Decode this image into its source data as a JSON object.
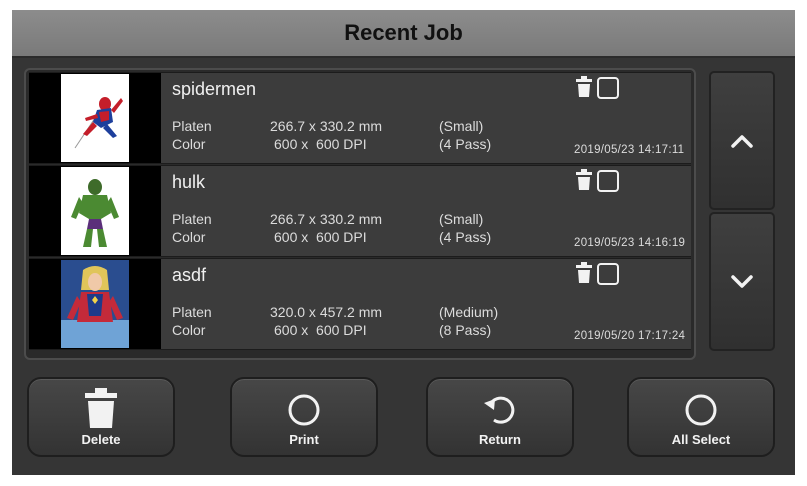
{
  "header": {
    "title": "Recent Job"
  },
  "jobs": [
    {
      "name": "spidermen",
      "platen_label": "Platen",
      "color_label": "Color",
      "platen_size": "266.7 x 330.2 mm",
      "resolution": "600 x  600 DPI",
      "size_class": "(Small)",
      "pass_mode": "(4 Pass)",
      "date": "2019/05/23 14:17:11",
      "thumbnail": "spider-man-image"
    },
    {
      "name": "hulk",
      "platen_label": "Platen",
      "color_label": "Color",
      "platen_size": "266.7 x 330.2 mm",
      "resolution": "600 x  600 DPI",
      "size_class": "(Small)",
      "pass_mode": "(4 Pass)",
      "date": "2019/05/23 14:16:19",
      "thumbnail": "hulk-image"
    },
    {
      "name": "asdf",
      "platen_label": "Platen",
      "color_label": "Color",
      "platen_size": "320.0 x 457.2 mm",
      "resolution": "600 x  600 DPI",
      "size_class": "(Medium)",
      "pass_mode": "(8 Pass)",
      "date": "2019/05/20 17:17:24",
      "thumbnail": "captain-marvel-image"
    }
  ],
  "scroll": {
    "up_icon": "chevron-up-icon",
    "down_icon": "chevron-down-icon"
  },
  "actions": {
    "delete_label": "Delete",
    "print_label": "Print",
    "return_label": "Return",
    "all_select_label": "All Select"
  },
  "colors": {
    "background": "#353535",
    "title_bar": "#858585",
    "row": "#3c3c3c",
    "text": "#dcdcdc"
  }
}
